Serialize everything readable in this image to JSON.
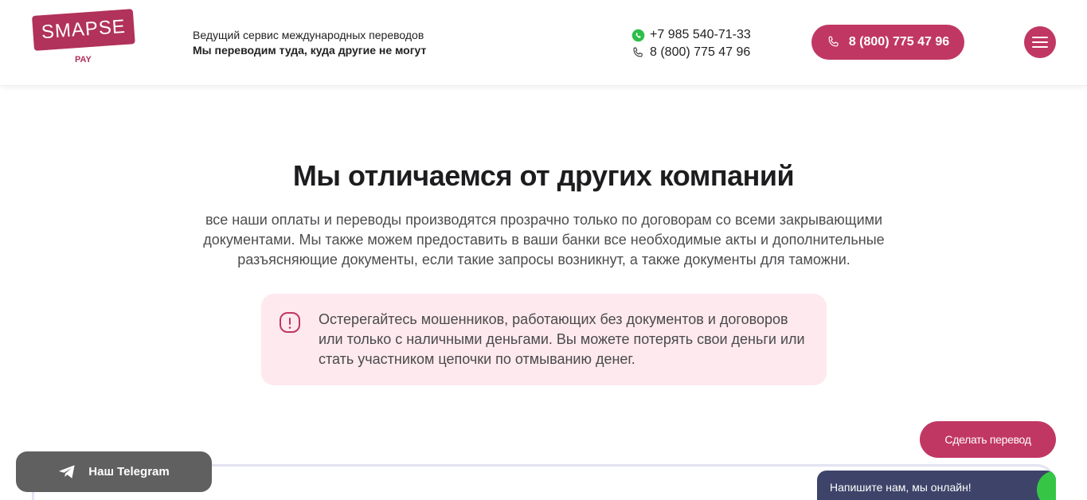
{
  "header": {
    "logo_text": "SMAPSE",
    "logo_sub": "PAY",
    "tagline_line1": "Ведущий сервис международных переводов",
    "tagline_line2": "Мы переводим туда, куда другие не могут",
    "whatsapp_phone": "+7 985 540-71-33",
    "landline_phone": "8 (800) 775 47 96",
    "call_button_label": "8 (800) 775 47 96",
    "menu_icon": "hamburger-icon"
  },
  "main": {
    "title": "Мы отличаемся от других компаний",
    "description": "все наши оплаты и переводы производятся прозрачно только по договорам со всеми закрывающими документами. Мы также можем предоставить в ваши банки все необходимые акты и дополнительные разъясняющие документы, если такие запросы возникнут, а также документы для таможни.",
    "warning_text": "Остерегайтесь мошенников, работающих без документов и договоров или только с наличными деньгами. Вы можете потерять свои деньги или стать участником цепочки по отмыванию денег."
  },
  "floating": {
    "transfer_button_label": "Сделать перевод",
    "telegram_button_label": "Наш Telegram",
    "chat_widget_text": "Напишите нам, мы онлайн!"
  },
  "colors": {
    "accent": "#c13763",
    "logo": "#b1325a",
    "warning_bg": "#fde9ee",
    "telegram_bg": "#606060",
    "chat_bg": "#3e4469",
    "online_dot": "#35c645"
  }
}
